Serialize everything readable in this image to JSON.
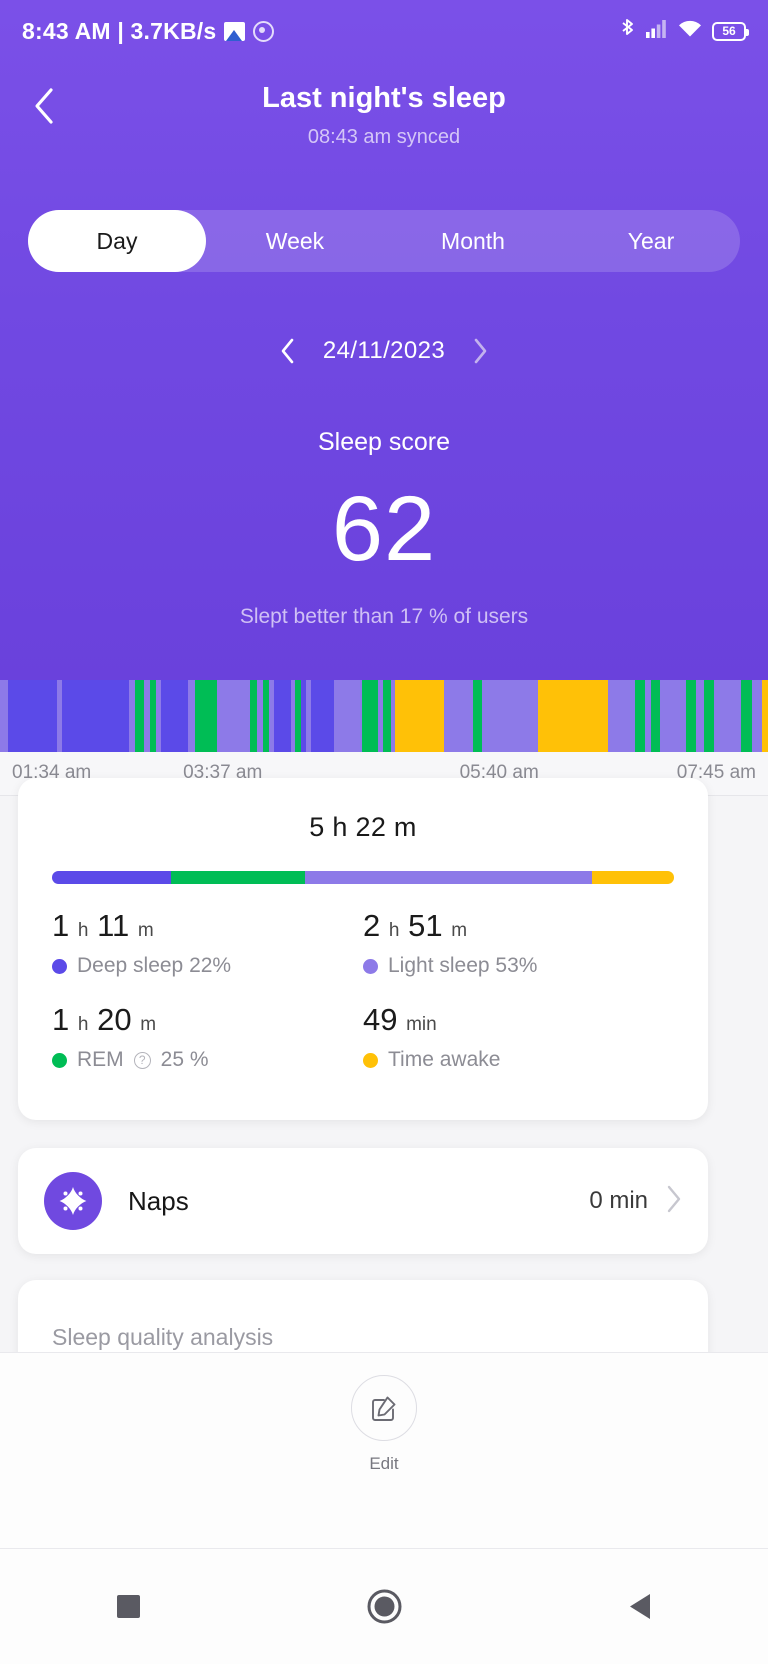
{
  "status_bar": {
    "time": "8:43 AM | 3.7KB/s",
    "icons": [
      "photo-icon",
      "face-icon",
      "bluetooth-icon",
      "cellular-signal-icon",
      "wifi-icon"
    ],
    "battery_level": "56"
  },
  "header": {
    "back_icon": "back-chevron-icon",
    "title": "Last night's sleep",
    "sync_status": "08:43 am synced",
    "accent_color": "#7049e0"
  },
  "tabs": [
    {
      "label": "Day",
      "active": true
    },
    {
      "label": "Week",
      "active": false
    },
    {
      "label": "Month",
      "active": false
    },
    {
      "label": "Year",
      "active": false
    }
  ],
  "date_nav": {
    "prev_icon": "chevron-left-icon",
    "date": "24/11/2023",
    "next_icon": "chevron-right-icon"
  },
  "score": {
    "label": "Sleep score",
    "value": "62",
    "subtitle": "Slept better than 17 % of users"
  },
  "chart_data": {
    "type": "bar",
    "title": "Sleep stages hypnogram",
    "xlabel": "",
    "ylabel": "",
    "grid": false,
    "legend_position": "below-chart",
    "categories": [
      "Deep sleep",
      "Light sleep",
      "REM",
      "Time awake"
    ],
    "values": [
      22,
      53,
      25,
      15
    ],
    "series": [
      {
        "name": "Deep sleep",
        "color": "#5b4ae8",
        "minutes": 71,
        "percent": 22,
        "display": "1 h 11 m"
      },
      {
        "name": "Light sleep",
        "color": "#8d7ae8",
        "minutes": 171,
        "percent": 53,
        "display": "2 h 51 m"
      },
      {
        "name": "REM",
        "color": "#00bd55",
        "minutes": 80,
        "percent": 25,
        "display": "1 h 20 m"
      },
      {
        "name": "Time awake",
        "color": "#ffc107",
        "minutes": 49,
        "percent": 15,
        "display": "49 min"
      }
    ],
    "axis_ticks": [
      "01:34 am",
      "03:37 am",
      "05:40 am",
      "07:45 am"
    ],
    "axis_tick_positions": [
      7,
      29,
      65,
      90
    ],
    "total_duration": "5 h 22 m",
    "segments": [
      {
        "stage": "Light sleep",
        "width": 0.8
      },
      {
        "stage": "Deep sleep",
        "width": 4.6
      },
      {
        "stage": "Light sleep",
        "width": 0.5
      },
      {
        "stage": "Deep sleep",
        "width": 6.4
      },
      {
        "stage": "Light sleep",
        "width": 0.5
      },
      {
        "stage": "REM",
        "width": 0.9
      },
      {
        "stage": "Light sleep",
        "width": 0.6
      },
      {
        "stage": "REM",
        "width": 0.5
      },
      {
        "stage": "Light sleep",
        "width": 0.5
      },
      {
        "stage": "Deep sleep",
        "width": 2.6
      },
      {
        "stage": "Light sleep",
        "width": 0.6
      },
      {
        "stage": "REM",
        "width": 2.1
      },
      {
        "stage": "Light sleep",
        "width": 3.2
      },
      {
        "stage": "REM",
        "width": 0.6
      },
      {
        "stage": "Light sleep",
        "width": 0.6
      },
      {
        "stage": "REM",
        "width": 0.6
      },
      {
        "stage": "Light sleep",
        "width": 0.5
      },
      {
        "stage": "Deep sleep",
        "width": 1.6
      },
      {
        "stage": "Light sleep",
        "width": 0.4
      },
      {
        "stage": "REM",
        "width": 0.5
      },
      {
        "stage": "Deep sleep",
        "width": 0.5
      },
      {
        "stage": "Light sleep",
        "width": 0.5
      },
      {
        "stage": "Deep sleep",
        "width": 2.2
      },
      {
        "stage": "Light sleep",
        "width": 2.6
      },
      {
        "stage": "REM",
        "width": 1.6
      },
      {
        "stage": "Light sleep",
        "width": 0.4
      },
      {
        "stage": "REM",
        "width": 0.8
      },
      {
        "stage": "Light sleep",
        "width": 0.4
      },
      {
        "stage": "Time awake",
        "width": 4.6
      },
      {
        "stage": "Light sleep",
        "width": 2.8
      },
      {
        "stage": "REM",
        "width": 0.8
      },
      {
        "stage": "Light sleep",
        "width": 5.4
      },
      {
        "stage": "Time awake",
        "width": 6.6
      },
      {
        "stage": "Light sleep",
        "width": 2.6
      },
      {
        "stage": "REM",
        "width": 0.9
      },
      {
        "stage": "Light sleep",
        "width": 0.6
      },
      {
        "stage": "REM",
        "width": 0.9
      },
      {
        "stage": "Light sleep",
        "width": 2.4
      },
      {
        "stage": "REM",
        "width": 1.0
      },
      {
        "stage": "Light sleep",
        "width": 0.8
      },
      {
        "stage": "REM",
        "width": 0.9
      },
      {
        "stage": "Light sleep",
        "width": 2.6
      },
      {
        "stage": "REM",
        "width": 1.0
      },
      {
        "stage": "Light sleep",
        "width": 1.0
      },
      {
        "stage": "Time awake",
        "width": 0.5
      }
    ]
  },
  "summary": {
    "total_duration": "5 h 22 m",
    "stats": [
      {
        "value": "1",
        "unit1": "h",
        "value2": "11",
        "unit2": "m",
        "label": "Deep sleep 22%",
        "color": "#5b4ae8",
        "has_info": false
      },
      {
        "value": "2",
        "unit1": "h",
        "value2": "51",
        "unit2": "m",
        "label": "Light sleep 53%",
        "color": "#8d7ae8",
        "has_info": false
      },
      {
        "value": "1",
        "unit1": "h",
        "value2": "20",
        "unit2": "m",
        "label": "REM",
        "label_tail": "25 %",
        "color": "#00bd55",
        "has_info": true
      },
      {
        "value": "49",
        "unit1": "min",
        "value2": "",
        "unit2": "",
        "label": "Time awake",
        "color": "#ffc107",
        "has_info": false
      }
    ]
  },
  "naps": {
    "icon": "sparkle-icon",
    "label": "Naps",
    "value": "0 min",
    "chevron": "chevron-right-icon"
  },
  "analysis": {
    "title": "Sleep quality analysis"
  },
  "bottom_sheet": {
    "edit_icon": "edit-pencil-square-icon",
    "edit_label": "Edit"
  },
  "nav_bar": {
    "recent_icon": "square-recents-icon",
    "home_icon": "circle-home-icon",
    "back_icon": "triangle-back-icon"
  }
}
